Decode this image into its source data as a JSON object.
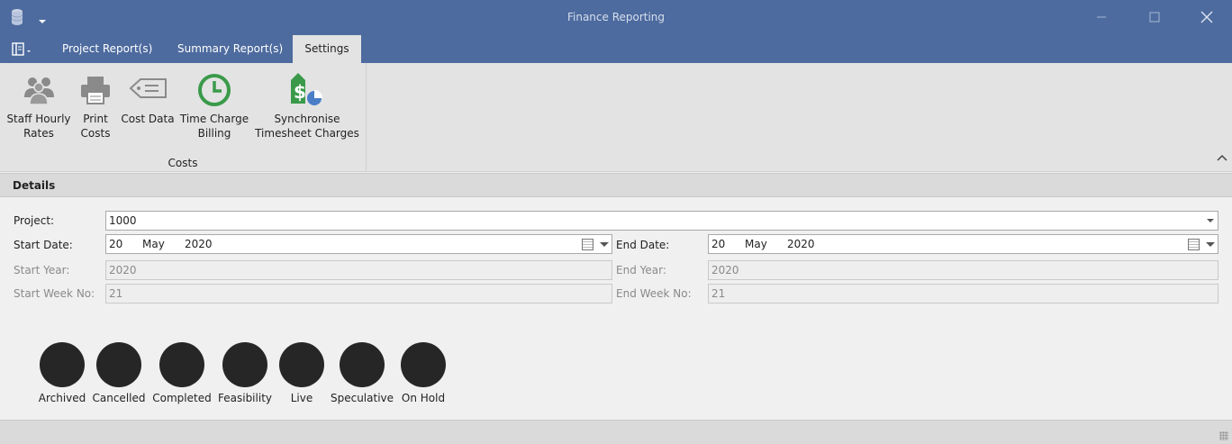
{
  "window": {
    "title": "Finance Reporting",
    "app_icon": "database-icon",
    "colors": {
      "chrome": "#4d6b9e",
      "ribbon": "#e3e3e3"
    }
  },
  "tabs": [
    {
      "label": "Project Report(s)"
    },
    {
      "label": "Summary Report(s)"
    },
    {
      "label": "Settings",
      "active": true
    }
  ],
  "ribbon": {
    "group_label": "Costs",
    "buttons": [
      {
        "label": "Staff Hourly Rates",
        "line1": "Staff Hourly",
        "line2": "Rates",
        "icon": "staff-icon"
      },
      {
        "label": "Print Costs",
        "line1": "Print",
        "line2": "Costs",
        "icon": "printer-icon"
      },
      {
        "label": "Cost Data",
        "line1": "Cost Data",
        "line2": "",
        "icon": "price-tag-icon"
      },
      {
        "label": "Time Charge Billing",
        "line1": "Time Charge",
        "line2": "Billing",
        "icon": "clock-icon"
      },
      {
        "label": "Synchronise Timesheet Charges",
        "line1": "Synchronise",
        "line2": "Timesheet Charges",
        "icon": "dollar-sync-icon"
      }
    ]
  },
  "details": {
    "header": "Details",
    "project_label": "Project:",
    "project_value": "1000",
    "start_date_label": "Start Date:",
    "start_date": {
      "day": "20",
      "month": "May",
      "year": "2020"
    },
    "end_date_label": "End Date:",
    "end_date": {
      "day": "20",
      "month": "May",
      "year": "2020"
    },
    "start_year_label": "Start Year:",
    "start_year_value": "2020",
    "end_year_label": "End Year:",
    "end_year_value": "2020",
    "start_week_label": "Start Week No:",
    "start_week_value": "21",
    "end_week_label": "End Week No:",
    "end_week_value": "21"
  },
  "statuses": [
    {
      "label": "Archived",
      "color": "#262626"
    },
    {
      "label": "Cancelled",
      "color": "#262626"
    },
    {
      "label": "Completed",
      "color": "#262626"
    },
    {
      "label": "Feasibility",
      "color": "#262626"
    },
    {
      "label": "Live",
      "color": "#262626"
    },
    {
      "label": "Speculative",
      "color": "#262626"
    },
    {
      "label": "On Hold",
      "color": "#262626"
    }
  ]
}
